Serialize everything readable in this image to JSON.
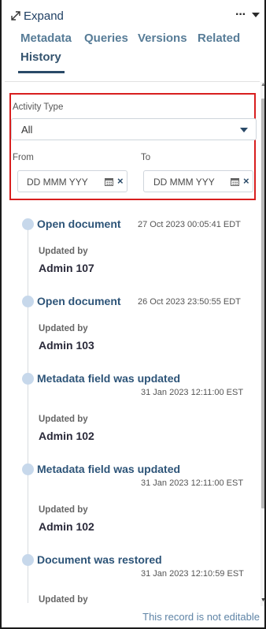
{
  "header": {
    "expand_label": "Expand",
    "more_label": "···"
  },
  "tabs": [
    {
      "label": "Metadata"
    },
    {
      "label": "Queries"
    },
    {
      "label": "Versions"
    },
    {
      "label": "Related"
    },
    {
      "label": "History",
      "active": true
    }
  ],
  "filters": {
    "activity_type_label": "Activity Type",
    "activity_type_value": "All",
    "from_label": "From",
    "to_label": "To",
    "from_placeholder": "DD MMM YYY",
    "to_placeholder": "DD MMM YYY"
  },
  "events": [
    {
      "title": "Open document",
      "date": "27 Oct 2023 00:05:41 EDT",
      "updated_by_label": "Updated by",
      "user": "Admin 107"
    },
    {
      "title": "Open document",
      "date": "26 Oct 2023 23:50:55 EDT",
      "updated_by_label": "Updated by",
      "user": "Admin 103"
    },
    {
      "title": "Metadata field was updated",
      "date": "31 Jan 2023 12:11:00 EST",
      "updated_by_label": "Updated by",
      "user": "Admin 102"
    },
    {
      "title": "Metadata field was updated",
      "date": "31 Jan 2023 12:11:00 EST",
      "updated_by_label": "Updated by",
      "user": "Admin 102"
    },
    {
      "title": "Document was restored",
      "date": "31 Jan 2023 12:10:59 EST",
      "updated_by_label": "Updated by",
      "user": ""
    }
  ],
  "footer": {
    "notice": "This record is not editable"
  },
  "colors": {
    "highlight_border": "#d81e1e",
    "tab_text": "#577c97",
    "event_title": "#2d5478",
    "timeline_dot": "#c7d8eb"
  }
}
